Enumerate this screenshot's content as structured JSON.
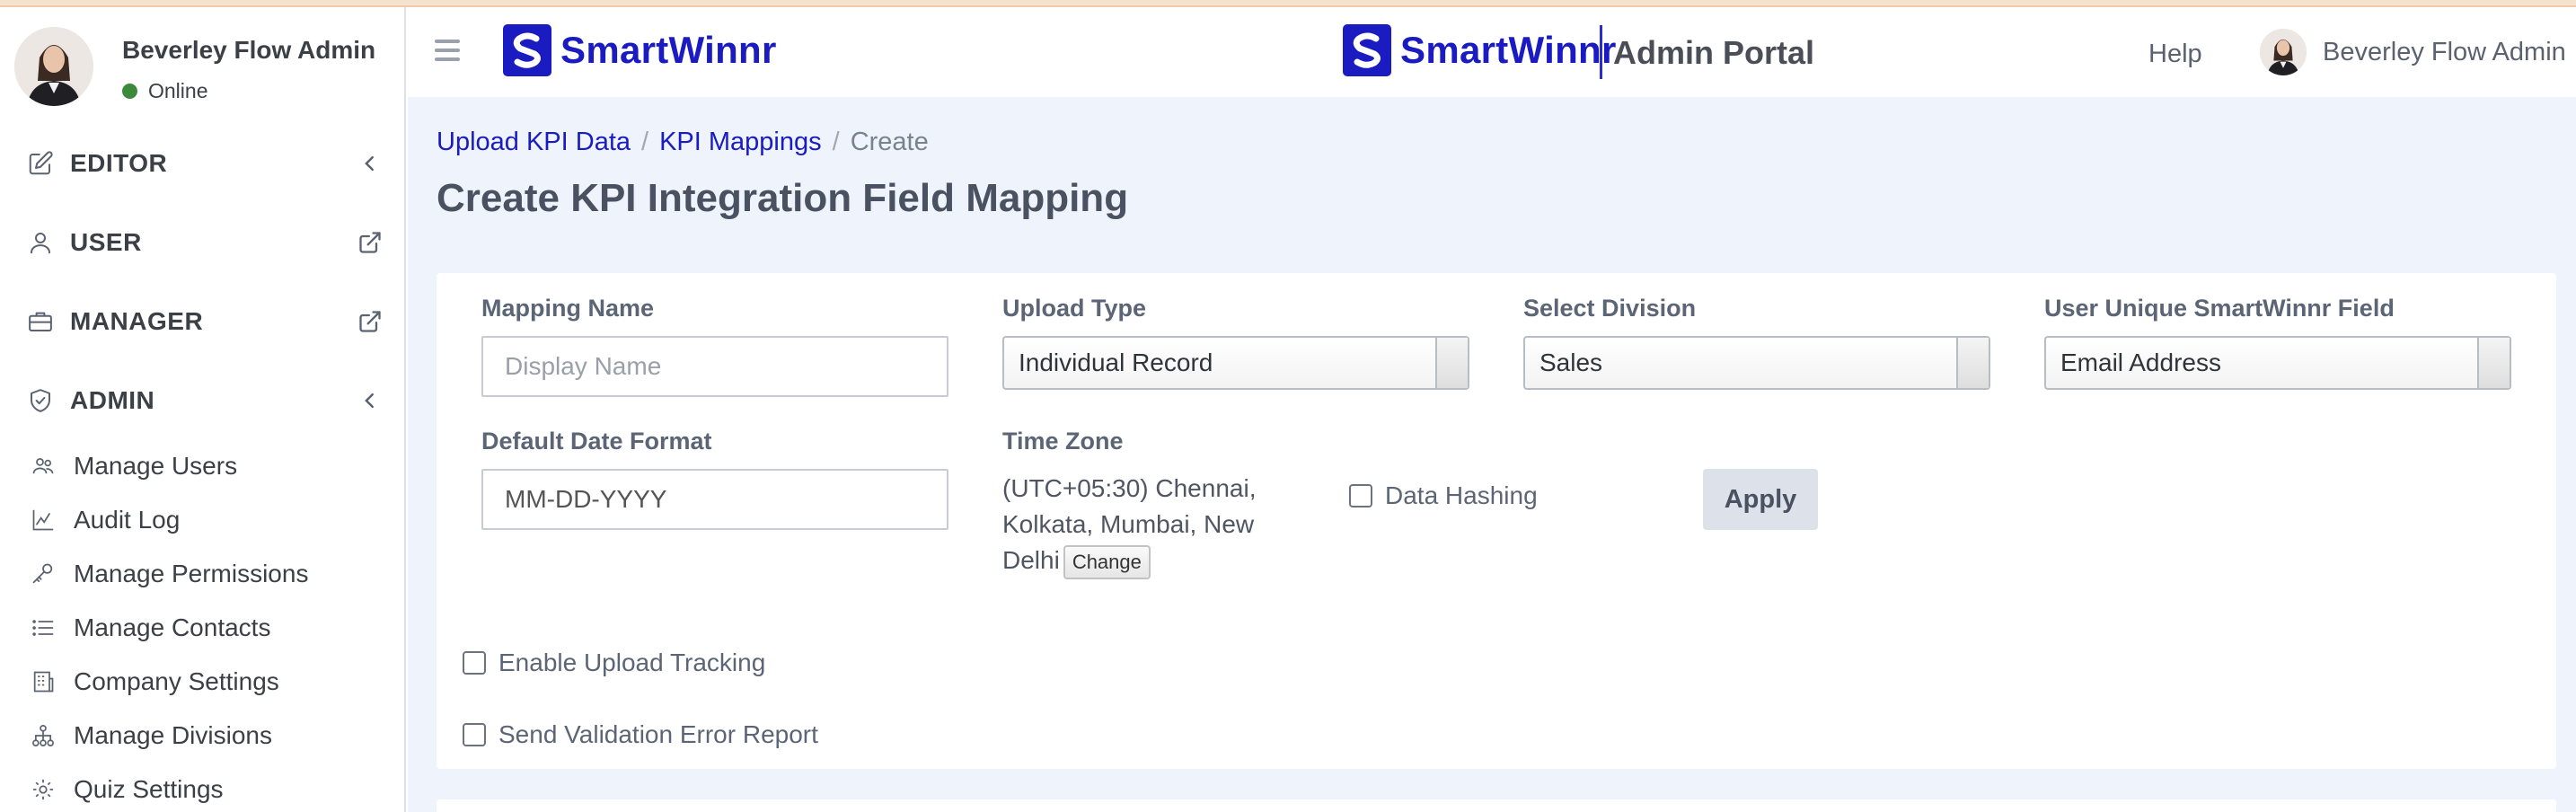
{
  "sidebar": {
    "user_name": "Beverley Flow Admin",
    "user_status": "Online",
    "sections": [
      {
        "label": "EDITOR",
        "icon": "edit-icon",
        "trail": "chevron-left-icon"
      },
      {
        "label": "USER",
        "icon": "user-icon",
        "trail": "external-link-icon"
      },
      {
        "label": "MANAGER",
        "icon": "briefcase-icon",
        "trail": "external-link-icon"
      },
      {
        "label": "ADMIN",
        "icon": "shield-icon",
        "trail": "chevron-left-icon"
      }
    ],
    "admin_items": [
      {
        "label": "Manage Users",
        "icon": "users-icon"
      },
      {
        "label": "Audit Log",
        "icon": "line-chart-icon"
      },
      {
        "label": "Manage Permissions",
        "icon": "key-icon"
      },
      {
        "label": "Manage Contacts",
        "icon": "list-icon"
      },
      {
        "label": "Company Settings",
        "icon": "building-icon"
      },
      {
        "label": "Manage Divisions",
        "icon": "hierarchy-icon"
      },
      {
        "label": "Quiz Settings",
        "icon": "gear-icon"
      }
    ]
  },
  "header": {
    "brand": "SmartWinnr",
    "center_brand": "SmartWinnr",
    "portal": "Admin Portal",
    "help": "Help",
    "user_name": "Beverley Flow Admin"
  },
  "breadcrumb": {
    "items": [
      "Upload KPI Data",
      "KPI Mappings"
    ],
    "current": "Create"
  },
  "page_title": "Create KPI Integration Field Mapping",
  "form": {
    "mapping_name_label": "Mapping Name",
    "mapping_name_placeholder": "Display Name",
    "upload_type_label": "Upload Type",
    "upload_type_value": "Individual Record",
    "division_label": "Select Division",
    "division_value": "Sales",
    "unique_field_label": "User Unique SmartWinnr Field",
    "unique_field_value": "Email Address",
    "date_format_label": "Default Date Format",
    "date_format_value": "MM-DD-YYYY",
    "time_zone_label": "Time Zone",
    "time_zone_value": "(UTC+05:30) Chennai, Kolkata, Mumbai, New Delhi",
    "change_label": "Change",
    "data_hashing_label": "Data Hashing",
    "apply_label": "Apply",
    "upload_tracking_label": "Enable Upload Tracking",
    "validation_report_label": "Send Validation Error Report"
  },
  "colors": {
    "brand": "#1a1bc1",
    "online": "#3b8a3e",
    "content_bg": "#eef3fc"
  }
}
